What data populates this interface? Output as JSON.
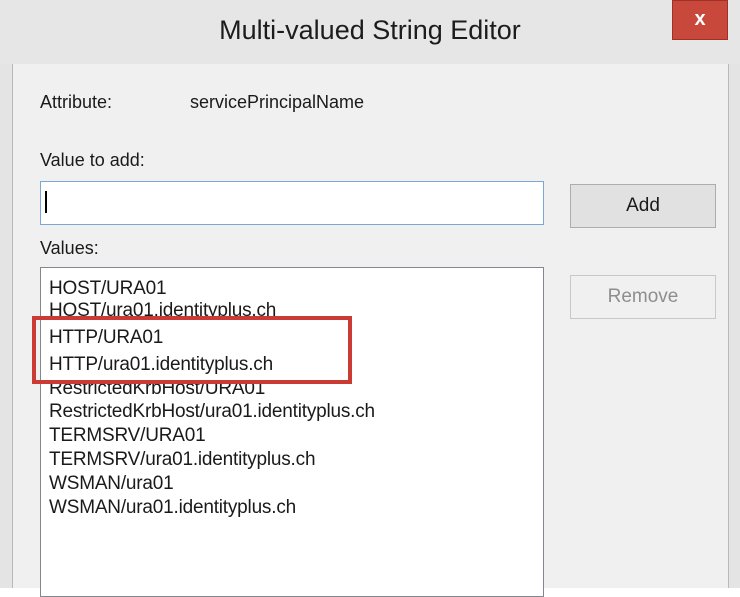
{
  "window": {
    "title": "Multi-valued String Editor",
    "close_label": "x"
  },
  "attribute": {
    "label": "Attribute:",
    "value": "servicePrincipalName"
  },
  "value_to_add": {
    "label": "Value to add:",
    "value": ""
  },
  "buttons": {
    "add_label": "Add",
    "remove_label": "Remove"
  },
  "values": {
    "label": "Values:",
    "items": [
      "HOST/URA01",
      "HOST/ura01.identityplus.ch",
      "HTTP/URA01",
      "HTTP/ura01.identityplus.ch",
      "RestrictedKrbHost/URA01",
      "RestrictedKrbHost/ura01.identityplus.ch",
      "TERMSRV/URA01",
      "TERMSRV/ura01.identityplus.ch",
      "WSMAN/ura01",
      "WSMAN/ura01.identityplus.ch"
    ]
  },
  "colors": {
    "close_button": "#c9483c",
    "highlight_box": "#cc3b33",
    "input_border": "#7aa7d6"
  }
}
